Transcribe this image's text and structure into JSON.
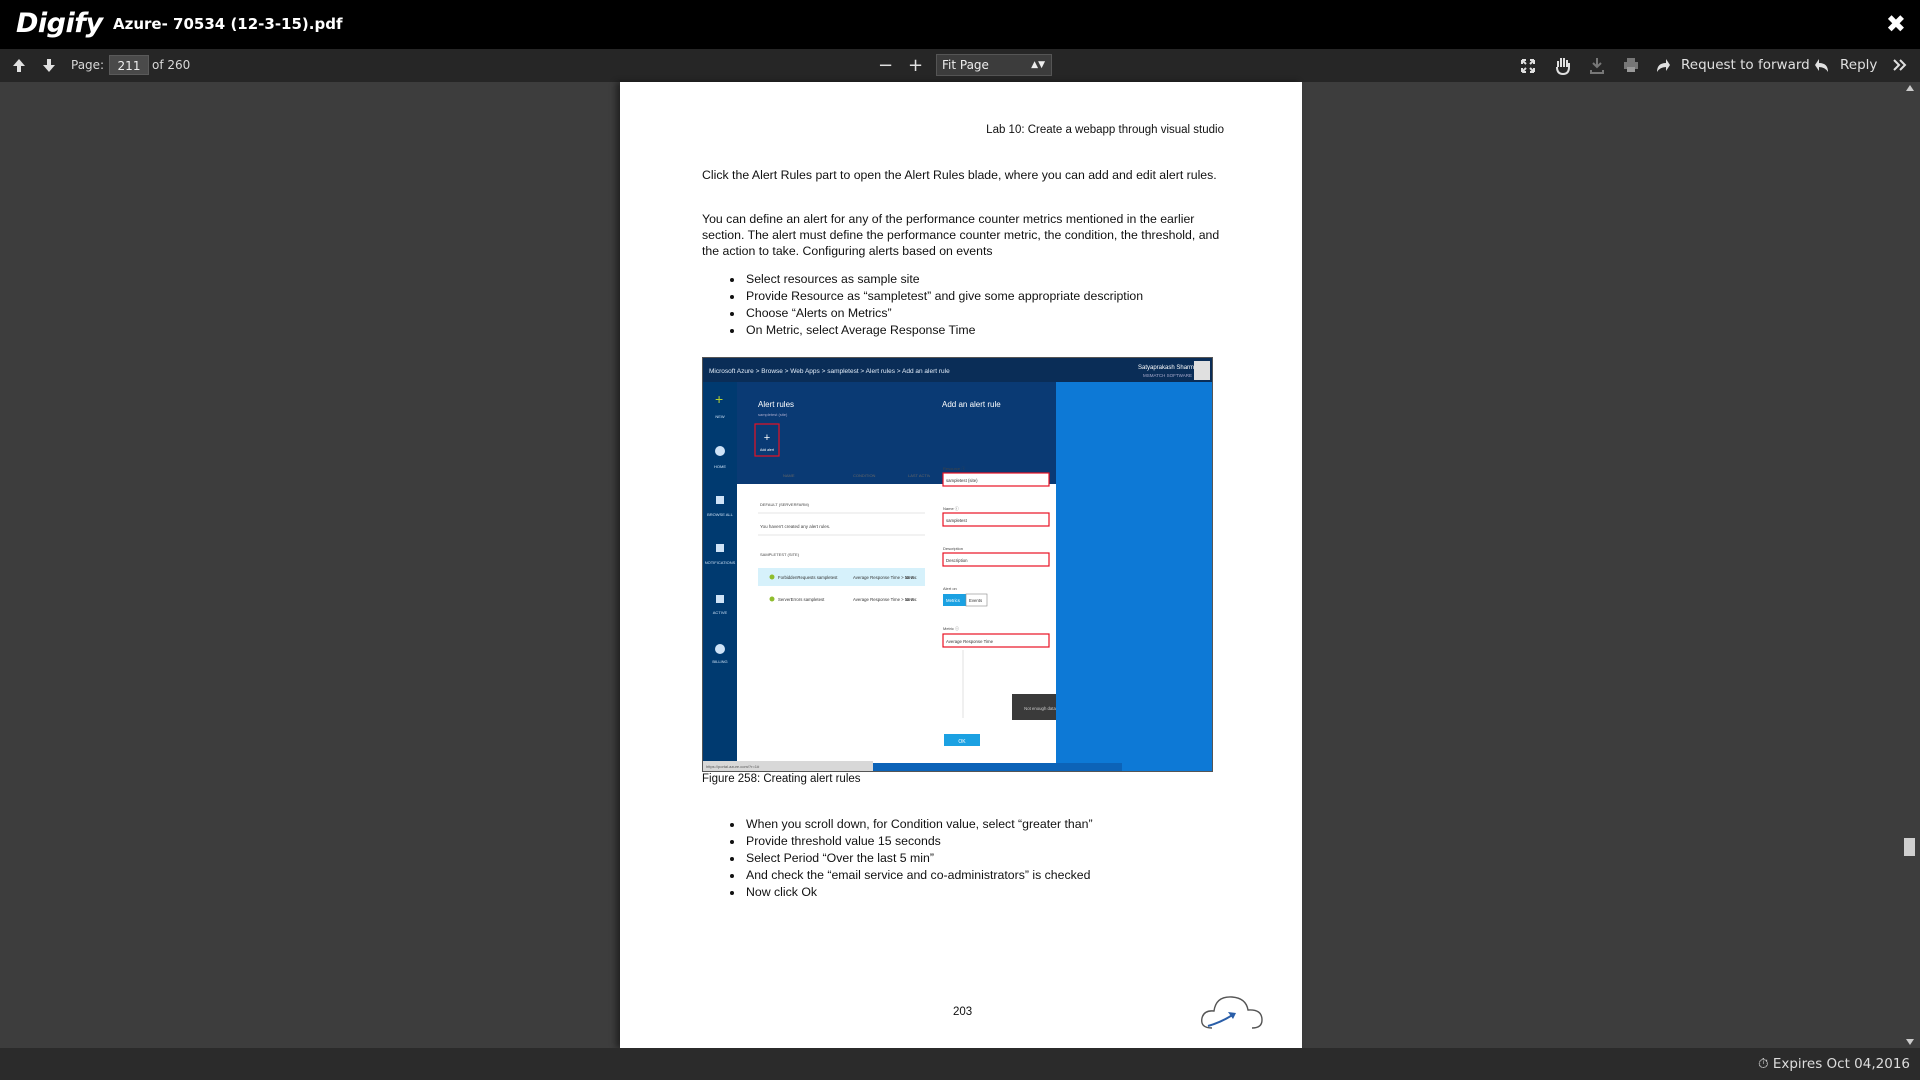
{
  "app": {
    "logo": "Digify",
    "title": "Azure- 70534 (12-3-15).pdf",
    "close_glyph": "✖"
  },
  "toolbar": {
    "page_label": "Page:",
    "current_page": "211",
    "of_total": "of 260",
    "zoom_value": "Fit Page",
    "zoom_out_glyph": "−",
    "zoom_in_glyph": "+",
    "request_forward": "Request to forward",
    "reply": "Reply"
  },
  "document": {
    "header": "Lab 10: Create a webapp through visual studio",
    "para1": "Click the Alert Rules part to open the Alert Rules blade, where you can add and edit alert rules.",
    "para2": "You can define an alert for any of the performance counter metrics mentioned in the earlier section. The alert must define the performance counter metric, the condition, the threshold, and the action to take. Configuring alerts based on events",
    "bullets1": [
      "Select resources as sample site",
      "Provide Resource as  “sampletest” and give some appropriate description",
      "Choose “Alerts on Metrics”",
      "On Metric, select Average Response Time"
    ],
    "figure_caption": "Figure 258: Creating alert rules",
    "bullets2": [
      "When you scroll down, for Condition value, select “greater than”",
      "Provide threshold value 15 seconds",
      "Select Period “Over the last 5 min”",
      "And check the “email service and co-administrators” is checked",
      "Now click Ok"
    ],
    "page_number": "203"
  },
  "figure": {
    "breadcrumb": "Microsoft Azure  >  Browse  >  Web Apps  >  sampletest  >  Alert rules  >  Add an alert rule",
    "user": "Satyaprakash Sharma",
    "user_sub": "MSMATCH SOFTWARE",
    "blade1_title": "Alert rules",
    "blade1_sub": "sampletest (site)",
    "add_alert": "Add alert",
    "col_name": "NAME",
    "col_condition": "CONDITION",
    "col_last_active": "LAST ACTIVE",
    "section_default": "DEFAULT (SERVERFARM)",
    "no_rules": "You haven't created any alert rules.",
    "section_sample": "SAMPLETEST (SITE)",
    "rule1_name": "ForbiddenRequests sampletest",
    "rule1_cond": "Average Response Time > 15 S...",
    "rule1_last": "Never",
    "rule2_name": "ServerErrors sampletest",
    "rule2_cond": "Average Response Time > 15 S...",
    "rule2_last": "Never",
    "blade2_title": "Add an alert rule",
    "resource_label": "Resource ⓘ",
    "resource_value": "sampletest (site)",
    "name_label": "Name ⓘ",
    "name_value": "sampletest",
    "desc_label": "Description",
    "desc_value": "Description",
    "alert_on_label": "Alert on",
    "alert_on_metrics": "Metrics",
    "alert_on_events": "Events",
    "metric_label": "Metric ⓘ",
    "metric_value": "Average Response Time",
    "no_data": "Not enough data",
    "ok": "OK",
    "status_url": "https://portal.azure.com/?r=1#",
    "nav": [
      "NEW",
      "HOME",
      "BROWSE ALL",
      "NOTIFICATIONS",
      "ACTIVE",
      "BILLING"
    ]
  },
  "footer": {
    "expires": "Expires Oct 04,2016"
  }
}
